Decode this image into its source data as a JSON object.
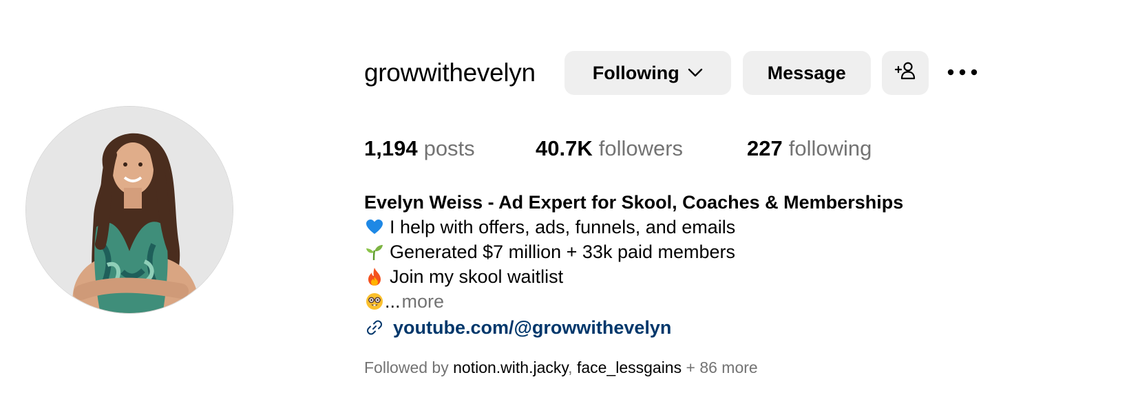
{
  "profile": {
    "username": "growwithevelyn",
    "avatar_alt": "avatar"
  },
  "actions": {
    "following_label": "Following",
    "message_label": "Message",
    "add_user_icon": "add-user-icon",
    "more_icon": "more-horizontal-icon",
    "chevron_icon": "chevron-down-icon"
  },
  "stats": {
    "posts_count": "1,194",
    "posts_label": "posts",
    "followers_count": "40.7K",
    "followers_label": "followers",
    "following_count": "227",
    "following_label": "following"
  },
  "bio": {
    "name": "Evelyn Weiss - Ad Expert for Skool, Coaches & Memberships",
    "lines": [
      {
        "emoji": "blue-heart-icon",
        "text": "I help with offers, ads, funnels, and emails"
      },
      {
        "emoji": "seedling-icon",
        "text": "Generated $7 million + 33k paid members"
      },
      {
        "emoji": "fire-icon",
        "text": "Join my skool waitlist"
      }
    ],
    "truncated_emoji": "nerd-face-icon",
    "ellipsis": "...",
    "more_label": "more",
    "link_icon": "link-icon",
    "link_text": "youtube.com/@growwithevelyn"
  },
  "followed_by": {
    "prefix": "Followed by",
    "accounts": [
      "notion.with.jacky",
      "face_lessgains"
    ],
    "separator": ",",
    "suffix": "+ 86 more"
  },
  "colors": {
    "secondary_text": "#737373",
    "link": "#00376b",
    "button_bg": "#efefef"
  }
}
